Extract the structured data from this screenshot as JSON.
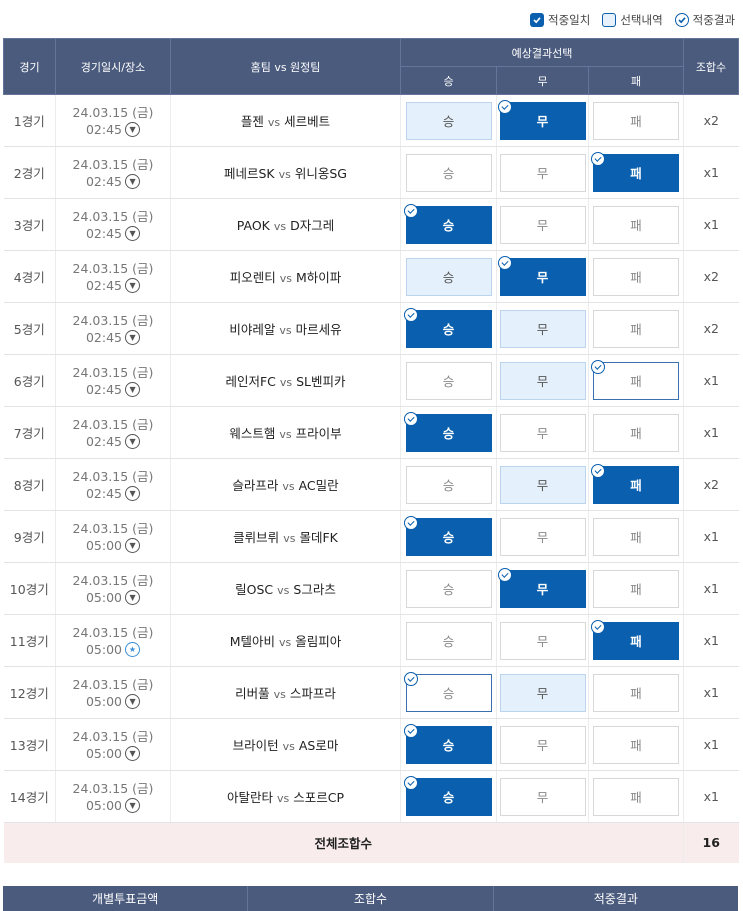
{
  "legend": {
    "hit": "적중일치",
    "selected": "선택내역",
    "result": "적중결과"
  },
  "header": {
    "game": "경기",
    "datetime": "경기일시/장소",
    "teams": "홈팀 vs 원정팀",
    "prediction": "예상결과선택",
    "win": "승",
    "draw": "무",
    "lose": "패",
    "combo": "조합수"
  },
  "vs_label": "vs",
  "rows": [
    {
      "no": "1경기",
      "date": "24.03.15 (금)",
      "time": "02:45",
      "home": "플젠",
      "away": "세르베트",
      "win": "승",
      "draw": "무",
      "lose": "패",
      "combo": "x2"
    },
    {
      "no": "2경기",
      "date": "24.03.15 (금)",
      "time": "02:45",
      "home": "페네르SK",
      "away": "위니옹SG",
      "win": "승",
      "draw": "무",
      "lose": "패",
      "combo": "x1"
    },
    {
      "no": "3경기",
      "date": "24.03.15 (금)",
      "time": "02:45",
      "home": "PAOK",
      "away": "D자그레",
      "win": "승",
      "draw": "무",
      "lose": "패",
      "combo": "x1"
    },
    {
      "no": "4경기",
      "date": "24.03.15 (금)",
      "time": "02:45",
      "home": "피오렌티",
      "away": "M하이파",
      "win": "승",
      "draw": "무",
      "lose": "패",
      "combo": "x2"
    },
    {
      "no": "5경기",
      "date": "24.03.15 (금)",
      "time": "02:45",
      "home": "비야레알",
      "away": "마르세유",
      "win": "승",
      "draw": "무",
      "lose": "패",
      "combo": "x2"
    },
    {
      "no": "6경기",
      "date": "24.03.15 (금)",
      "time": "02:45",
      "home": "레인저FC",
      "away": "SL벤피카",
      "win": "승",
      "draw": "무",
      "lose": "패",
      "combo": "x1"
    },
    {
      "no": "7경기",
      "date": "24.03.15 (금)",
      "time": "02:45",
      "home": "웨스트햄",
      "away": "프라이부",
      "win": "승",
      "draw": "무",
      "lose": "패",
      "combo": "x1"
    },
    {
      "no": "8경기",
      "date": "24.03.15 (금)",
      "time": "02:45",
      "home": "슬라프라",
      "away": "AC밀란",
      "win": "승",
      "draw": "무",
      "lose": "패",
      "combo": "x2"
    },
    {
      "no": "9경기",
      "date": "24.03.15 (금)",
      "time": "05:00",
      "home": "클뤼브뤼",
      "away": "몰데FK",
      "win": "승",
      "draw": "무",
      "lose": "패",
      "combo": "x1"
    },
    {
      "no": "10경기",
      "date": "24.03.15 (금)",
      "time": "05:00",
      "home": "릴OSC",
      "away": "S그라츠",
      "win": "승",
      "draw": "무",
      "lose": "패",
      "combo": "x1"
    },
    {
      "no": "11경기",
      "date": "24.03.15 (금)",
      "time": "05:00",
      "home": "M텔아비",
      "away": "올림피아",
      "win": "승",
      "draw": "무",
      "lose": "패",
      "combo": "x1"
    },
    {
      "no": "12경기",
      "date": "24.03.15 (금)",
      "time": "05:00",
      "home": "리버풀",
      "away": "스파프라",
      "win": "승",
      "draw": "무",
      "lose": "패",
      "combo": "x1"
    },
    {
      "no": "13경기",
      "date": "24.03.15 (금)",
      "time": "05:00",
      "home": "브라이턴",
      "away": "AS로마",
      "win": "승",
      "draw": "무",
      "lose": "패",
      "combo": "x1"
    },
    {
      "no": "14경기",
      "date": "24.03.15 (금)",
      "time": "05:00",
      "home": "아탈란타",
      "away": "스포르CP",
      "win": "승",
      "draw": "무",
      "lose": "패",
      "combo": "x1"
    }
  ],
  "total": {
    "label": "전체조합수",
    "value": "16"
  },
  "footer": {
    "amount": "개별투표금액",
    "combo": "조합수",
    "result": "적중결과"
  },
  "colors": {
    "header_bg": "#4b5b7e",
    "hit_blue": "#0a5fae",
    "selected_bg": "#e4f0fb",
    "total_bg": "#f9ecec"
  }
}
